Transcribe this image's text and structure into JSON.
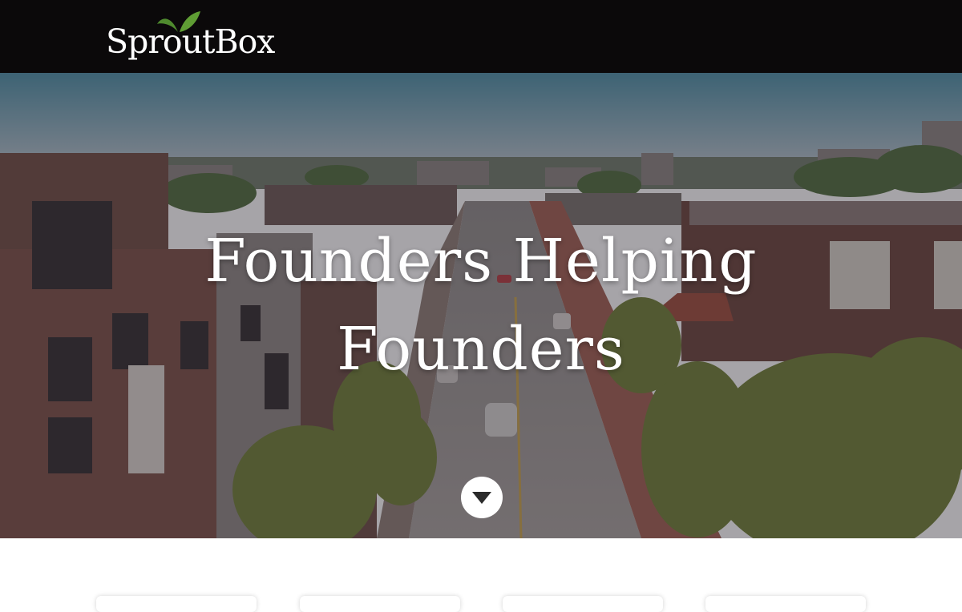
{
  "header": {
    "logo_text": "SproutBox",
    "background": "#0b090a"
  },
  "hero": {
    "title": "Founders Helping Founders",
    "scroll_button_icon": "chevron-down-icon",
    "overlay_color": "#3b3640"
  },
  "cards": {
    "count": 4
  }
}
